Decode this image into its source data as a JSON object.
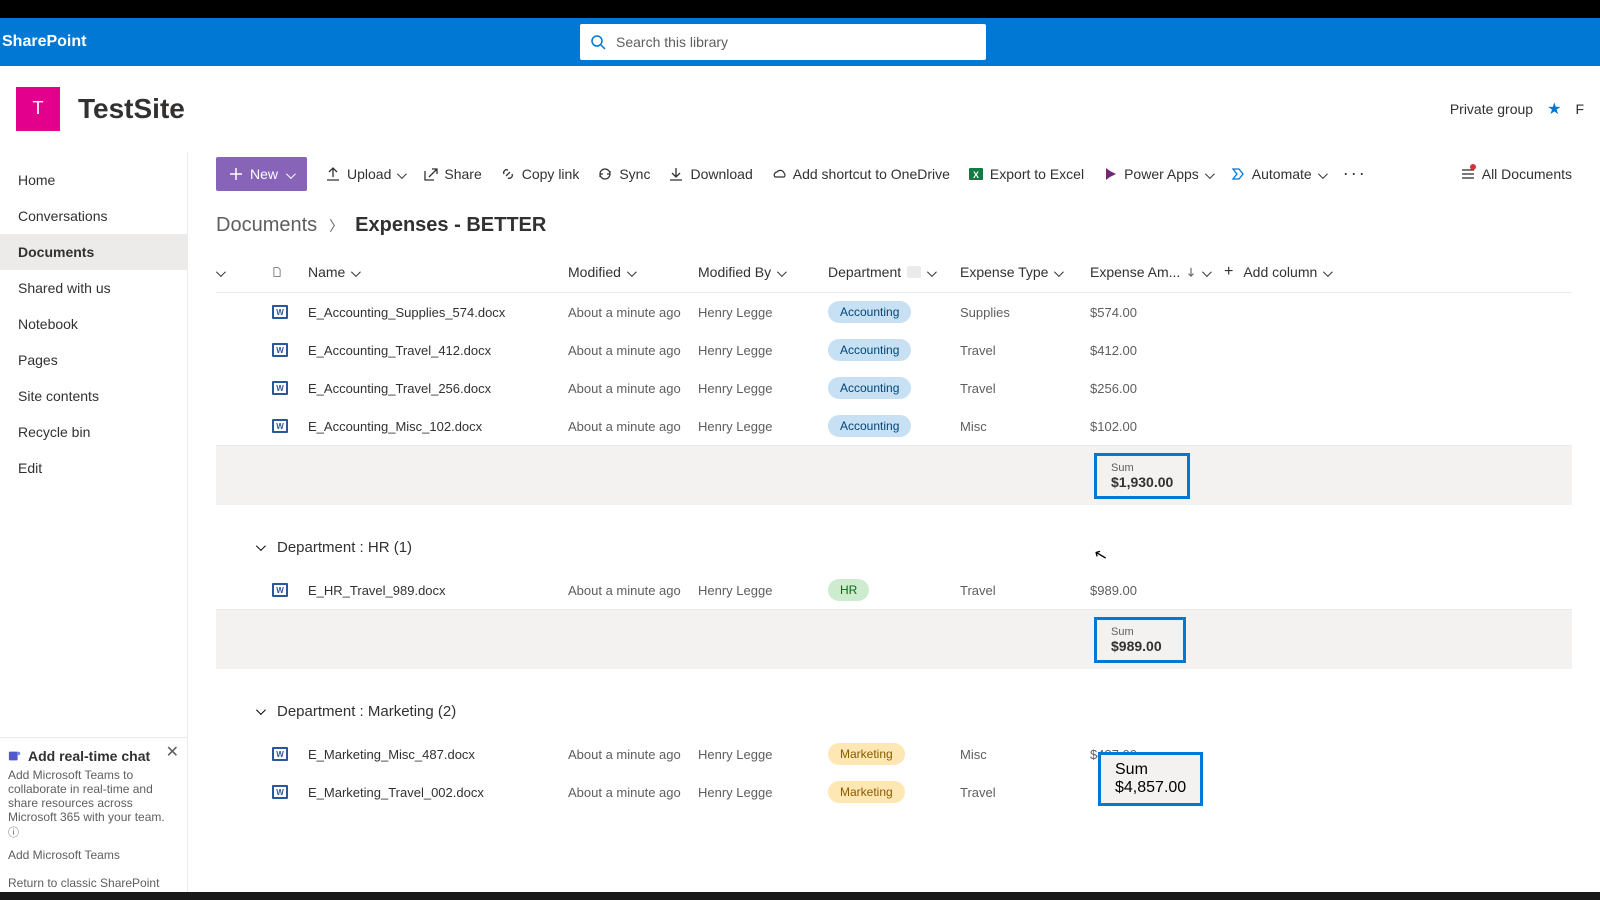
{
  "app": {
    "name": "SharePoint"
  },
  "search": {
    "placeholder": "Search this library"
  },
  "site": {
    "initial": "T",
    "name": "TestSite",
    "privacy": "Private group"
  },
  "nav": {
    "items": [
      {
        "label": "Home"
      },
      {
        "label": "Conversations"
      },
      {
        "label": "Documents"
      },
      {
        "label": "Shared with us"
      },
      {
        "label": "Notebook"
      },
      {
        "label": "Pages"
      },
      {
        "label": "Site contents"
      },
      {
        "label": "Recycle bin"
      },
      {
        "label": "Edit"
      }
    ],
    "activeIndex": 2
  },
  "chatPromo": {
    "title": "Add real-time chat",
    "body": "Add Microsoft Teams to collaborate in real-time and share resources across Microsoft 365 with your team.",
    "link": "Add Microsoft Teams"
  },
  "classicLink": "Return to classic SharePoint",
  "toolbar": {
    "new": "New",
    "upload": "Upload",
    "share": "Share",
    "copylink": "Copy link",
    "sync": "Sync",
    "download": "Download",
    "addShortcut": "Add shortcut to OneDrive",
    "exportExcel": "Export to Excel",
    "powerApps": "Power Apps",
    "automate": "Automate",
    "views": "All Documents"
  },
  "breadcrumb": {
    "root": "Documents",
    "current": "Expenses - BETTER"
  },
  "columns": {
    "name": "Name",
    "modified": "Modified",
    "modifiedBy": "Modified By",
    "department": "Department",
    "expenseType": "Expense Type",
    "expenseAmount": "Expense Am...",
    "addColumn": "Add column"
  },
  "groups": [
    {
      "header": "",
      "sumLabel": "Sum",
      "sumValue": "$1,930.00",
      "rows": [
        {
          "name": "E_Accounting_Supplies_574.docx",
          "modified": "About a minute ago",
          "modifiedBy": "Henry Legge",
          "dept": "Accounting",
          "type": "Supplies",
          "amt": "$574.00"
        },
        {
          "name": "E_Accounting_Travel_412.docx",
          "modified": "About a minute ago",
          "modifiedBy": "Henry Legge",
          "dept": "Accounting",
          "type": "Travel",
          "amt": "$412.00"
        },
        {
          "name": "E_Accounting_Travel_256.docx",
          "modified": "About a minute ago",
          "modifiedBy": "Henry Legge",
          "dept": "Accounting",
          "type": "Travel",
          "amt": "$256.00"
        },
        {
          "name": "E_Accounting_Misc_102.docx",
          "modified": "About a minute ago",
          "modifiedBy": "Henry Legge",
          "dept": "Accounting",
          "type": "Misc",
          "amt": "$102.00"
        }
      ]
    },
    {
      "header": "Department : HR (1)",
      "sumLabel": "Sum",
      "sumValue": "$989.00",
      "rows": [
        {
          "name": "E_HR_Travel_989.docx",
          "modified": "About a minute ago",
          "modifiedBy": "Henry Legge",
          "dept": "HR",
          "type": "Travel",
          "amt": "$989.00"
        }
      ]
    },
    {
      "header": "Department : Marketing (2)",
      "sumLabel": "Sum",
      "sumValue": "$4,857.00",
      "rows": [
        {
          "name": "E_Marketing_Misc_487.docx",
          "modified": "About a minute ago",
          "modifiedBy": "Henry Legge",
          "dept": "Marketing",
          "type": "Misc",
          "amt": "$487.00"
        },
        {
          "name": "E_Marketing_Travel_002.docx",
          "modified": "About a minute ago",
          "modifiedBy": "Henry Legge",
          "dept": "Marketing",
          "type": "Travel",
          "amt": ""
        }
      ]
    }
  ]
}
